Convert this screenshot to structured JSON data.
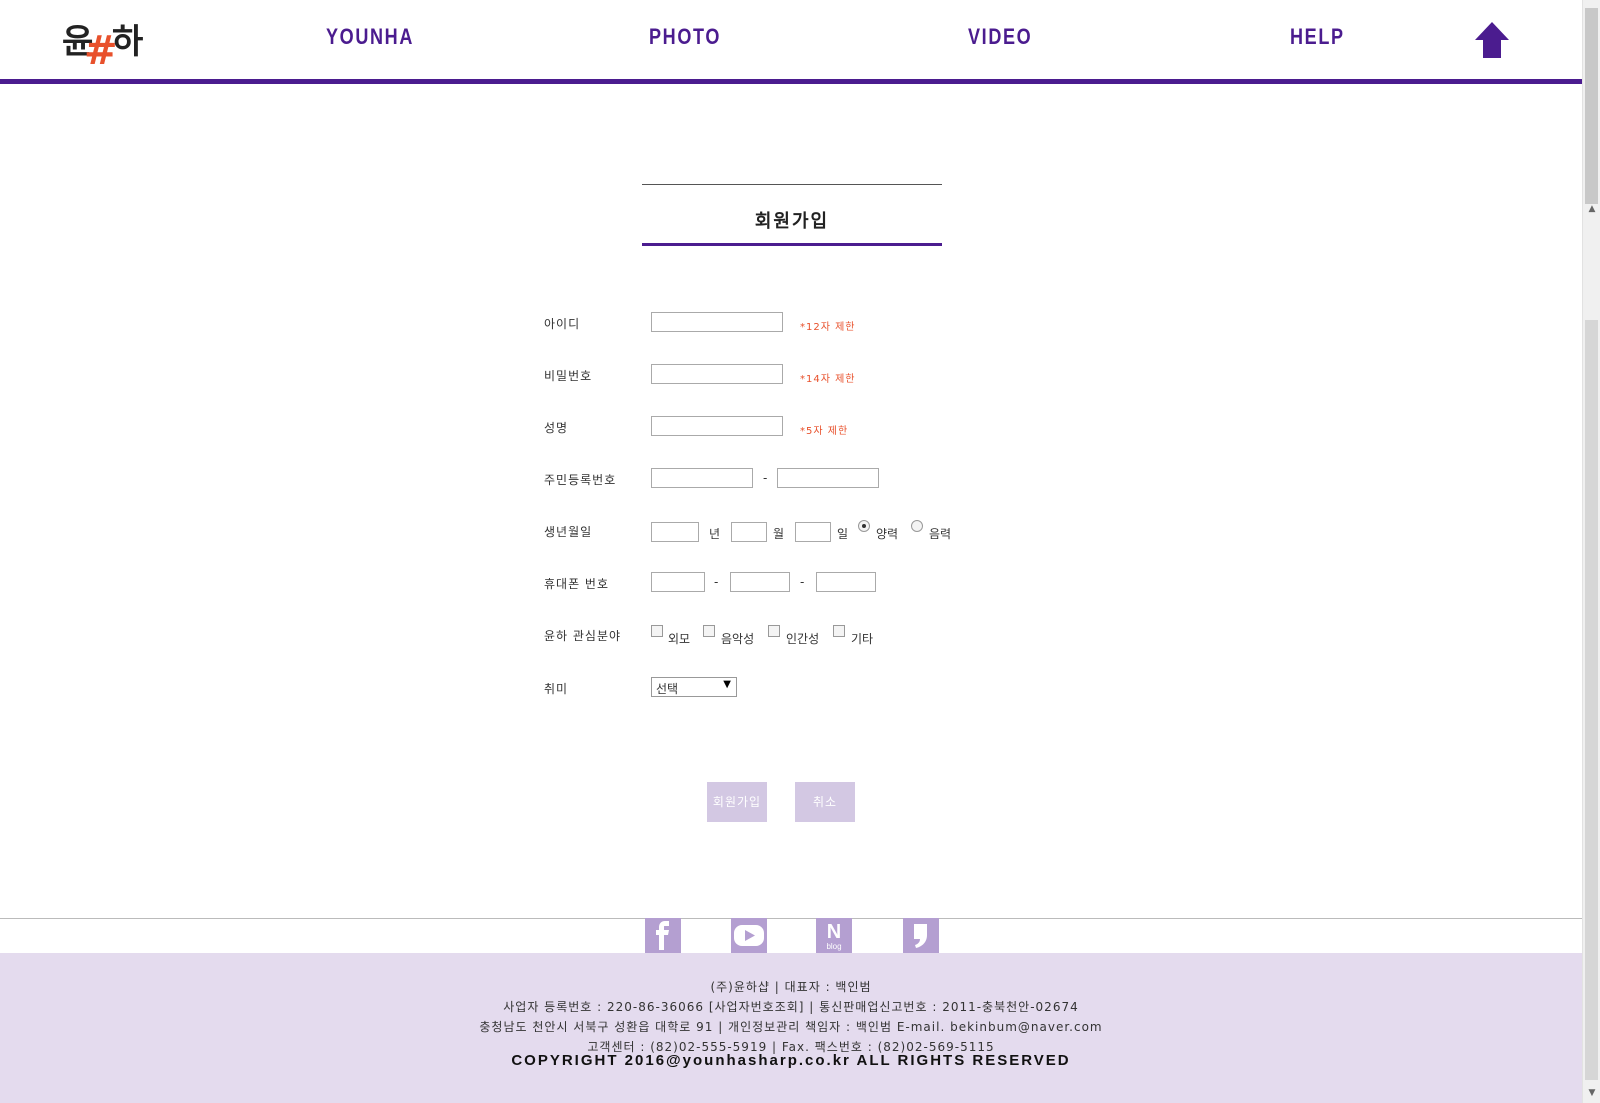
{
  "header": {
    "logo": {
      "part1": "윤",
      "part2": "#",
      "part3": "하"
    },
    "nav": [
      "YOUNHA",
      "PHOTO",
      "VIDEO",
      "HELP"
    ],
    "accent_color": "#4b1c8f",
    "home_icon": "home-icon"
  },
  "form": {
    "title": "회원가입",
    "id_label": "아이디",
    "id_hint": "*12자 제한",
    "password_label": "비밀번호",
    "password_hint": "*14자 제한",
    "name_label": "성명",
    "name_hint": "*5자 제한",
    "rrn_label": "주민등록번호",
    "rrn_separator": "-",
    "birth_label": "생년월일",
    "birth_year_unit": "년",
    "birth_month_unit": "월",
    "birth_day_unit": "일",
    "birth_solar": "양력",
    "birth_lunar": "음력",
    "phone_label": "휴대폰 번호",
    "phone_sep1": "-",
    "phone_sep2": "-",
    "interest_label": "윤하 관심분야",
    "interests": [
      "외모",
      "음악성",
      "인간성",
      "기타"
    ],
    "hobby_label": "취미",
    "hobby_selected": "선택",
    "submit_label": "회원가입",
    "cancel_label": "취소"
  },
  "footer": {
    "social_icons": [
      "facebook-icon",
      "youtube-icon",
      "naver-blog-icon",
      "kakao-story-icon"
    ],
    "line1": "(주)윤하샵 | 대표자 : 백인범",
    "line2": "사업자 등록번호 : 220-86-36066 [사업자번호조회] | 통신판매업신고번호 : 2011-충북천안-02674",
    "line3": "충청남도 천안시 서북구 성환읍 대학로 91 | 개인정보관리 책임자 : 백인범 E-mail. bekinbum@naver.com",
    "line4": "고객센터 : (82)02-555-5919 | Fax. 팩스번호 : (82)02-569-5115",
    "copyright": "COPYRIGHT 2016@younhasharp.co.kr ALL RIGHTS RESERVED"
  }
}
